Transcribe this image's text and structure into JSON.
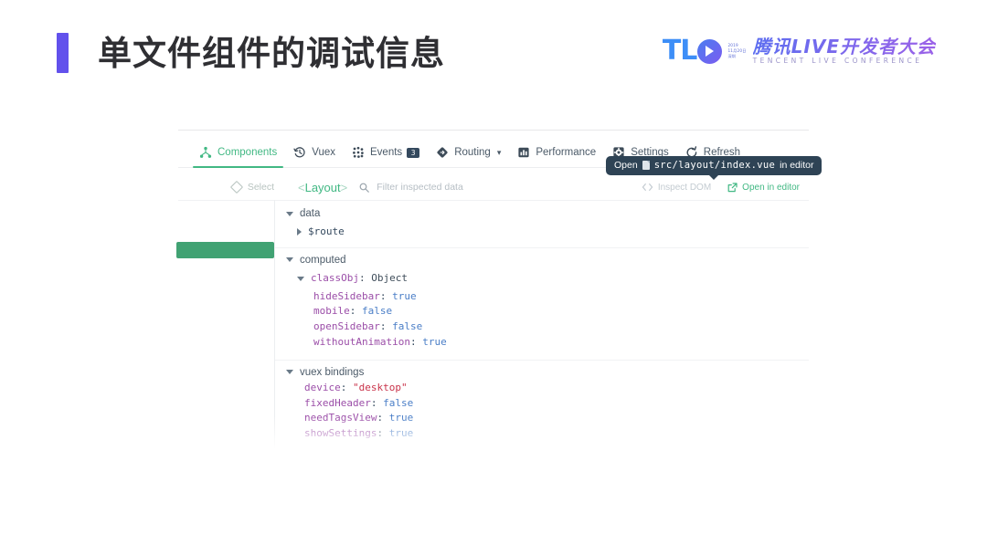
{
  "slide": {
    "title": "单文件组件的调试信息",
    "accent_color": "#6251ec"
  },
  "logo": {
    "mark": "TL",
    "dates": [
      "2019",
      "11月20日",
      "深圳"
    ],
    "cn_name": "腾讯LIVE开发者大会",
    "en_name": "TENCENT LIVE CONFERENCE"
  },
  "devtools": {
    "accent_color": "#41b883",
    "tabs": [
      {
        "label": "Components",
        "icon": "components-tree-icon",
        "active": true,
        "badge": "",
        "chevron": false
      },
      {
        "label": "Vuex",
        "icon": "history-clock-icon",
        "active": false,
        "badge": "",
        "chevron": false
      },
      {
        "label": "Events",
        "icon": "events-dots-icon",
        "active": false,
        "badge": "3",
        "chevron": false
      },
      {
        "label": "Routing",
        "icon": "routing-diamond-icon",
        "active": false,
        "badge": "",
        "chevron": true
      },
      {
        "label": "Performance",
        "icon": "performance-bars-icon",
        "active": false,
        "badge": "",
        "chevron": false
      },
      {
        "label": "Settings",
        "icon": "gear-icon",
        "active": false,
        "badge": "",
        "chevron": false
      },
      {
        "label": "Refresh",
        "icon": "refresh-icon",
        "active": false,
        "badge": "",
        "chevron": false
      }
    ],
    "subbar": {
      "select_label": "Select",
      "component_name": "<Layout>",
      "filter_placeholder": "Filter inspected data",
      "inspect_dom_label": "Inspect DOM",
      "open_in_editor_label": "Open in editor"
    },
    "tooltip": {
      "prefix": "Open",
      "path": "src/layout/index.vue",
      "suffix": "in editor"
    },
    "sections": [
      {
        "name": "data",
        "expanded": true,
        "children": [
          {
            "kind": "collapsed",
            "key": "$route"
          }
        ]
      },
      {
        "name": "computed",
        "expanded": true,
        "children": [
          {
            "kind": "object",
            "key": "classObj",
            "type": "Object"
          },
          {
            "kind": "prop",
            "key": "hideSidebar",
            "value": "true",
            "value_type": "boolean"
          },
          {
            "kind": "prop",
            "key": "mobile",
            "value": "false",
            "value_type": "boolean"
          },
          {
            "kind": "prop",
            "key": "openSidebar",
            "value": "false",
            "value_type": "boolean"
          },
          {
            "kind": "prop",
            "key": "withoutAnimation",
            "value": "true",
            "value_type": "boolean"
          }
        ]
      },
      {
        "name": "vuex bindings",
        "expanded": true,
        "children": [
          {
            "kind": "prop",
            "key": "device",
            "value": "\"desktop\"",
            "value_type": "string"
          },
          {
            "kind": "prop",
            "key": "fixedHeader",
            "value": "false",
            "value_type": "boolean"
          },
          {
            "kind": "prop",
            "key": "needTagsView",
            "value": "true",
            "value_type": "boolean"
          },
          {
            "kind": "prop",
            "key": "showSettings",
            "value": "true",
            "value_type": "boolean"
          }
        ]
      }
    ]
  }
}
